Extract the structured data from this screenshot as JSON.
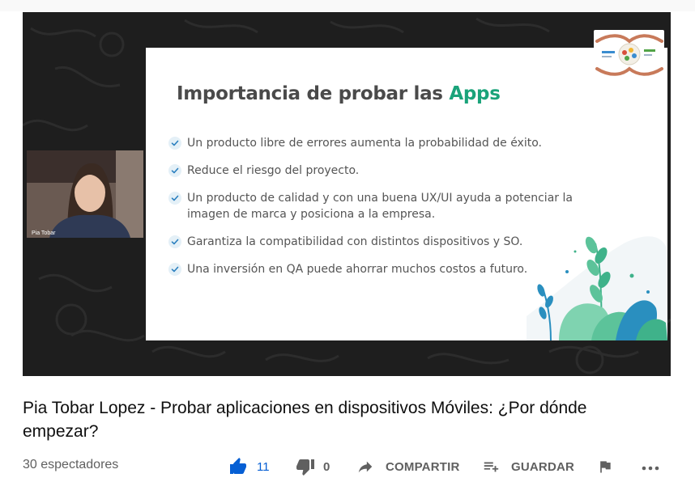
{
  "slide": {
    "title_main": "Importancia de probar las ",
    "title_accent": "Apps",
    "bullets": [
      "Un producto libre de errores aumenta la probabilidad de éxito.",
      "Reduce el riesgo del proyecto.",
      "Un producto de calidad y con una buena UX/UI ayuda a potenciar la imagen de marca y posiciona a la empresa.",
      "Garantiza la compatibilidad con distintos dispositivos y SO.",
      "Una inversión en QA puede ahorrar muchos costos a futuro."
    ]
  },
  "webcam": {
    "name": "Pia Tobar"
  },
  "video": {
    "title": "Pia Tobar Lopez - Probar aplicaciones en dispositivos Móviles: ¿Por dónde empezar?",
    "views": "30 espectadores"
  },
  "actions": {
    "like_count": "11",
    "dislike_count": "0",
    "share_label": "COMPARTIR",
    "save_label": "GUARDAR"
  },
  "colors": {
    "accent": "#1aa37a",
    "like_blue": "#065fd4",
    "player_bg": "#1e1e1e"
  },
  "icons": [
    "thumb-up-icon",
    "thumb-down-icon",
    "share-icon",
    "playlist-add-icon",
    "flag-icon",
    "more-icon",
    "check-icon",
    "plant-illustration",
    "logo-hands"
  ]
}
